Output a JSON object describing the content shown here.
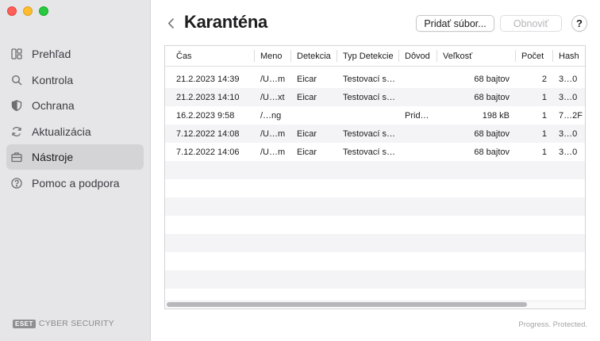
{
  "sidebar": {
    "items": [
      {
        "label": "Prehľad",
        "icon": "dashboard-icon"
      },
      {
        "label": "Kontrola",
        "icon": "search-icon"
      },
      {
        "label": "Ochrana",
        "icon": "shield-icon"
      },
      {
        "label": "Aktualizácia",
        "icon": "refresh-icon"
      },
      {
        "label": "Nástroje",
        "icon": "briefcase-icon",
        "active": true
      },
      {
        "label": "Pomoc a podpora",
        "icon": "help-circle-icon"
      }
    ],
    "brand_logo": "eset",
    "brand_text": "CYBER SECURITY"
  },
  "header": {
    "title": "Karanténa",
    "add_file_label": "Pridať súbor...",
    "refresh_label": "Obnoviť",
    "help_label": "?"
  },
  "table": {
    "columns": [
      "Čas",
      "Meno",
      "Detekcia",
      "Typ Detekcie",
      "Dôvod",
      "Veľkosť",
      "Počet",
      "Hash"
    ],
    "rows": [
      {
        "cas": "21.2.2023 14:39",
        "meno": "/U…m",
        "detekcia": "Eicar",
        "typ": "Testovací s…",
        "dovod": "",
        "velkost": "68 bajtov",
        "pocet": "2",
        "hash": "3…0"
      },
      {
        "cas": "21.2.2023 14:10",
        "meno": "/U…xt",
        "detekcia": "Eicar",
        "typ": "Testovací s…",
        "dovod": "",
        "velkost": "68 bajtov",
        "pocet": "1",
        "hash": "3…0"
      },
      {
        "cas": "16.2.2023 9:58",
        "meno": "/…ng",
        "detekcia": "",
        "typ": "",
        "dovod": "Prid…",
        "velkost": "198 kB",
        "pocet": "1",
        "hash": "7…2F"
      },
      {
        "cas": "7.12.2022 14:08",
        "meno": "/U…m",
        "detekcia": "Eicar",
        "typ": "Testovací s…",
        "dovod": "",
        "velkost": "68 bajtov",
        "pocet": "1",
        "hash": "3…0"
      },
      {
        "cas": "7.12.2022 14:06",
        "meno": "/U…m",
        "detekcia": "Eicar",
        "typ": "Testovací s…",
        "dovod": "",
        "velkost": "68 bajtov",
        "pocet": "1",
        "hash": "3…0"
      }
    ]
  },
  "footer": {
    "slogan": "Progress. Protected."
  }
}
